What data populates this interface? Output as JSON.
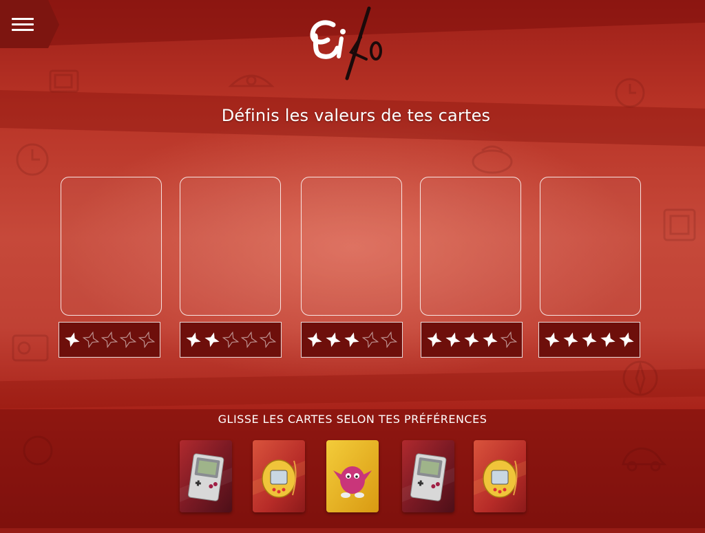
{
  "app": {
    "logo_text": "Eiko"
  },
  "header": {
    "title": "Définis les valeurs de tes cartes"
  },
  "slots": [
    {
      "stars": 1,
      "max": 5
    },
    {
      "stars": 2,
      "max": 5
    },
    {
      "stars": 3,
      "max": 5
    },
    {
      "stars": 4,
      "max": 5
    },
    {
      "stars": 5,
      "max": 5
    }
  ],
  "instruction": "GLISSE LES CARTES SELON TES PRÉFÉRENCES",
  "cards": [
    {
      "icon": "gameboy-card-icon",
      "style": "red"
    },
    {
      "icon": "tamagotchi-card-icon",
      "style": "orange"
    },
    {
      "icon": "pink-monster-card-icon",
      "style": "yellow"
    },
    {
      "icon": "gameboy-card-icon",
      "style": "red"
    },
    {
      "icon": "tamagotchi-card-icon",
      "style": "orange"
    }
  ],
  "colors": {
    "background": "#b42c22",
    "rating_box": "#6e0f0b",
    "card_yellow": "#e6b21c",
    "card_red": "#8e1c1c"
  }
}
